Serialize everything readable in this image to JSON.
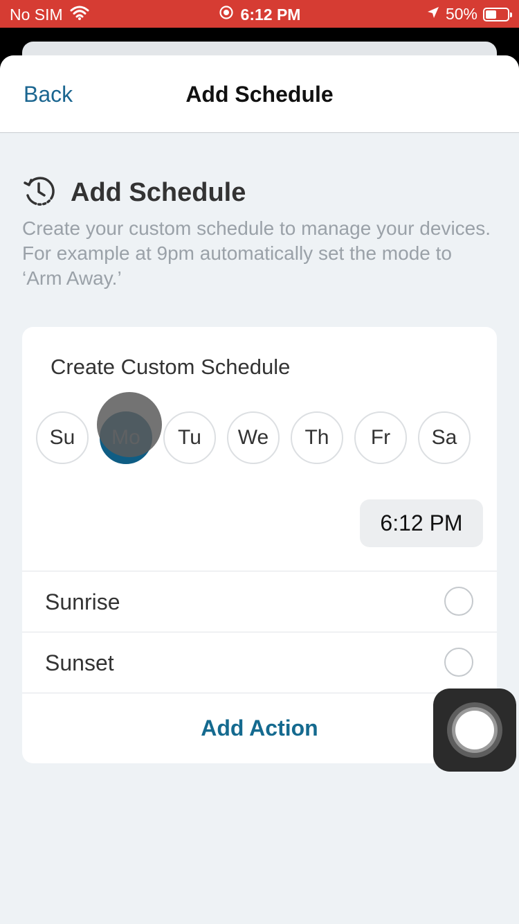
{
  "status_bar": {
    "carrier": "No SIM",
    "time": "6:12 PM",
    "battery_percent": "50%",
    "battery_level": 0.5,
    "icons": [
      "wifi-icon",
      "screen-record-icon",
      "location-icon",
      "battery-icon"
    ]
  },
  "nav": {
    "back_label": "Back",
    "title": "Add Schedule"
  },
  "section": {
    "icon": "schedule-history-icon",
    "title": "Add Schedule",
    "description": "Create your custom schedule to manage your devices. For example at 9pm automatically set the mode to ‘Arm Away.’"
  },
  "card": {
    "title": "Create Custom Schedule",
    "days": [
      {
        "label": "Su",
        "selected": false
      },
      {
        "label": "Mo",
        "selected": true
      },
      {
        "label": "Tu",
        "selected": false
      },
      {
        "label": "We",
        "selected": false
      },
      {
        "label": "Th",
        "selected": false
      },
      {
        "label": "Fr",
        "selected": false
      },
      {
        "label": "Sa",
        "selected": false
      }
    ],
    "time": "6:12 PM",
    "options": [
      {
        "label": "Sunrise",
        "checked": false
      },
      {
        "label": "Sunset",
        "checked": false
      }
    ],
    "add_action_label": "Add Action"
  },
  "colors": {
    "status_bar": "#d63c33",
    "accent": "#156a8f",
    "selected_day": "#0f5d84",
    "background": "#eef2f5"
  }
}
